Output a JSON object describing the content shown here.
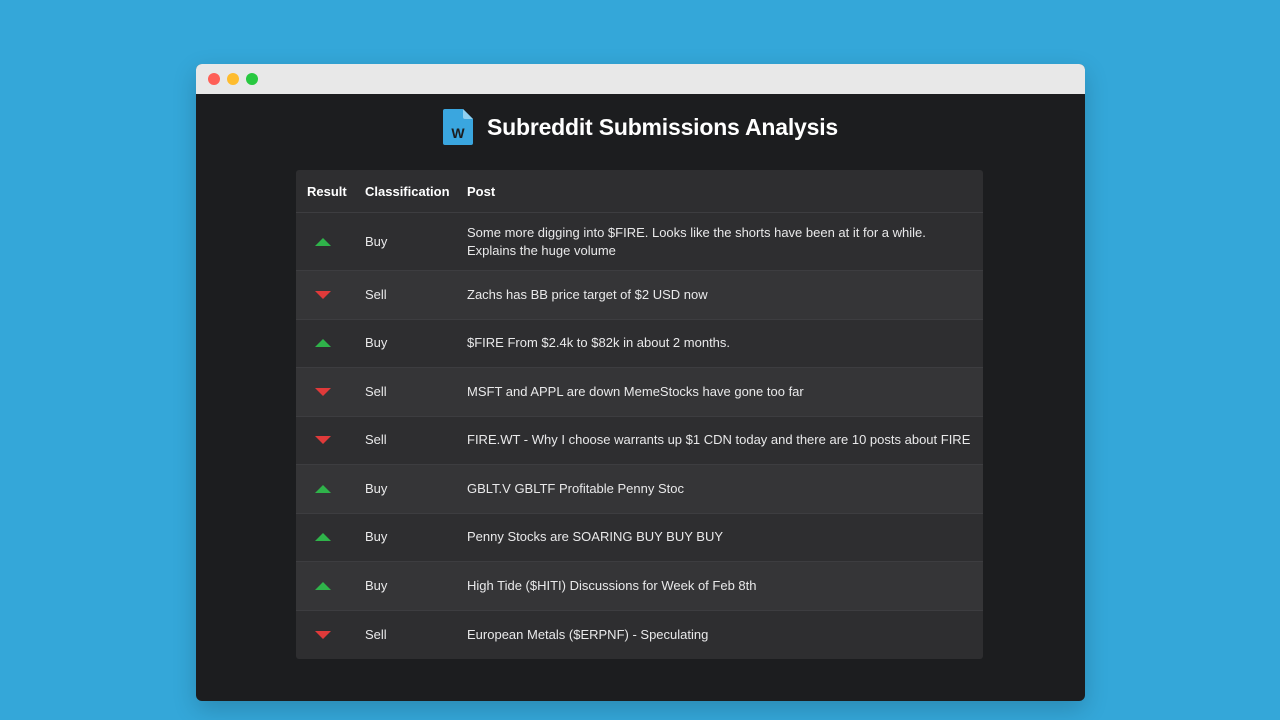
{
  "app": {
    "title": "Subreddit Submissions Analysis",
    "logo_icon": "word-document-icon",
    "logo_letter": "W",
    "logo_color": "#3aa6df"
  },
  "table": {
    "headers": {
      "result": "Result",
      "classification": "Classification",
      "post": "Post"
    },
    "rows": [
      {
        "result": "up",
        "classification": "Buy",
        "post": "Some more digging into $FIRE. Looks like the shorts have been at it for a while. Explains the huge volume"
      },
      {
        "result": "down",
        "classification": "Sell",
        "post": "Zachs has BB price target of $2 USD now"
      },
      {
        "result": "up",
        "classification": "Buy",
        "post": "$FIRE From $2.4k to $82k in about 2 months."
      },
      {
        "result": "down",
        "classification": "Sell",
        "post": "MSFT and APPL are down MemeStocks have gone too far"
      },
      {
        "result": "down",
        "classification": "Sell",
        "post": "FIRE.WT - Why I choose warrants up $1 CDN today and there are 10 posts about FIRE"
      },
      {
        "result": "up",
        "classification": "Buy",
        "post": "GBLT.V GBLTF Profitable Penny Stoc"
      },
      {
        "result": "up",
        "classification": "Buy",
        "post": "Penny Stocks are SOARING BUY BUY BUY"
      },
      {
        "result": "up",
        "classification": "Buy",
        "post": "High Tide ($HITI) Discussions for Week of Feb 8th"
      },
      {
        "result": "down",
        "classification": "Sell",
        "post": "European Metals ($ERPNF) - Speculating"
      }
    ]
  },
  "colors": {
    "background": "#34a7d9",
    "buy": "#2fb34a",
    "sell": "#e03a3a"
  }
}
